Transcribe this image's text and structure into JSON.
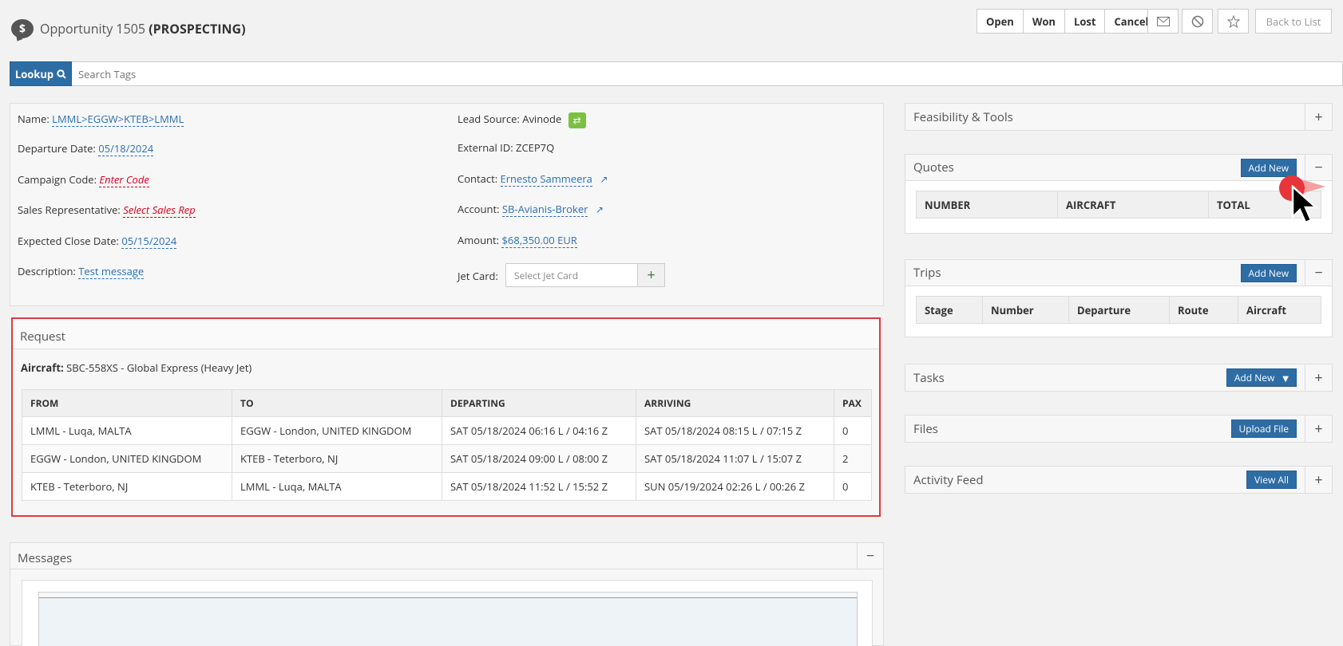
{
  "header": {
    "title_prefix": "Opportunity 1505",
    "status": "(PROSPECTING)",
    "actions": [
      "Open",
      "Won",
      "Lost",
      "Cancel"
    ],
    "back_label": "Back to List"
  },
  "search": {
    "lookup_label": "Lookup",
    "placeholder": "Search Tags"
  },
  "details": {
    "name_label": "Name:",
    "name_value": "LMML>EGGW>KTEB>LMML",
    "departure_label": "Departure Date:",
    "departure_value": "05/18/2024",
    "campaign_label": "Campaign Code:",
    "campaign_value": "Enter Code",
    "salesrep_label": "Sales Representative:",
    "salesrep_value": "Select Sales Rep",
    "close_label": "Expected Close Date:",
    "close_value": "05/15/2024",
    "desc_label": "Description:",
    "desc_value": "Test message",
    "lead_label": "Lead Source:",
    "lead_value": "Avinode",
    "external_label": "External ID:",
    "external_value": "ZCEP7Q",
    "contact_label": "Contact:",
    "contact_value": "Ernesto Sammeera",
    "account_label": "Account:",
    "account_value": "SB-Avianis-Broker",
    "amount_label": "Amount:",
    "amount_value": "$68,350.00 EUR",
    "jetcard_label": "Jet Card:",
    "jetcard_placeholder": "Select Jet Card"
  },
  "request": {
    "title": "Request",
    "aircraft_label": "Aircraft:",
    "aircraft_value": "SBC-558XS - Global Express (Heavy Jet)",
    "columns": [
      "FROM",
      "TO",
      "DEPARTING",
      "ARRIVING",
      "PAX"
    ],
    "rows": [
      [
        "LMML - Luqa, MALTA",
        "EGGW - London, UNITED KINGDOM",
        "SAT 05/18/2024 06:16 L / 04:16 Z",
        "SAT 05/18/2024 08:15 L / 07:15 Z",
        "0"
      ],
      [
        "EGGW - London, UNITED KINGDOM",
        "KTEB - Teterboro, NJ",
        "SAT 05/18/2024 09:00 L / 08:00 Z",
        "SAT 05/18/2024 11:07 L / 15:07 Z",
        "2"
      ],
      [
        "KTEB - Teterboro, NJ",
        "LMML - Luqa, MALTA",
        "SAT 05/18/2024 11:52 L / 15:52 Z",
        "SUN 05/19/2024 02:26 L / 00:26 Z",
        "0"
      ]
    ]
  },
  "messages": {
    "title": "Messages"
  },
  "right": {
    "feasibility": {
      "title": "Feasibility & Tools"
    },
    "quotes": {
      "title": "Quotes",
      "button": "Add New",
      "columns": [
        "NUMBER",
        "AIRCRAFT",
        "TOTAL"
      ]
    },
    "trips": {
      "title": "Trips",
      "button": "Add New",
      "columns": [
        "Stage",
        "Number",
        "Departure",
        "Route",
        "Aircraft"
      ]
    },
    "tasks": {
      "title": "Tasks",
      "button": "Add New"
    },
    "files": {
      "title": "Files",
      "button": "Upload File"
    },
    "activity": {
      "title": "Activity Feed",
      "button": "View All"
    }
  }
}
